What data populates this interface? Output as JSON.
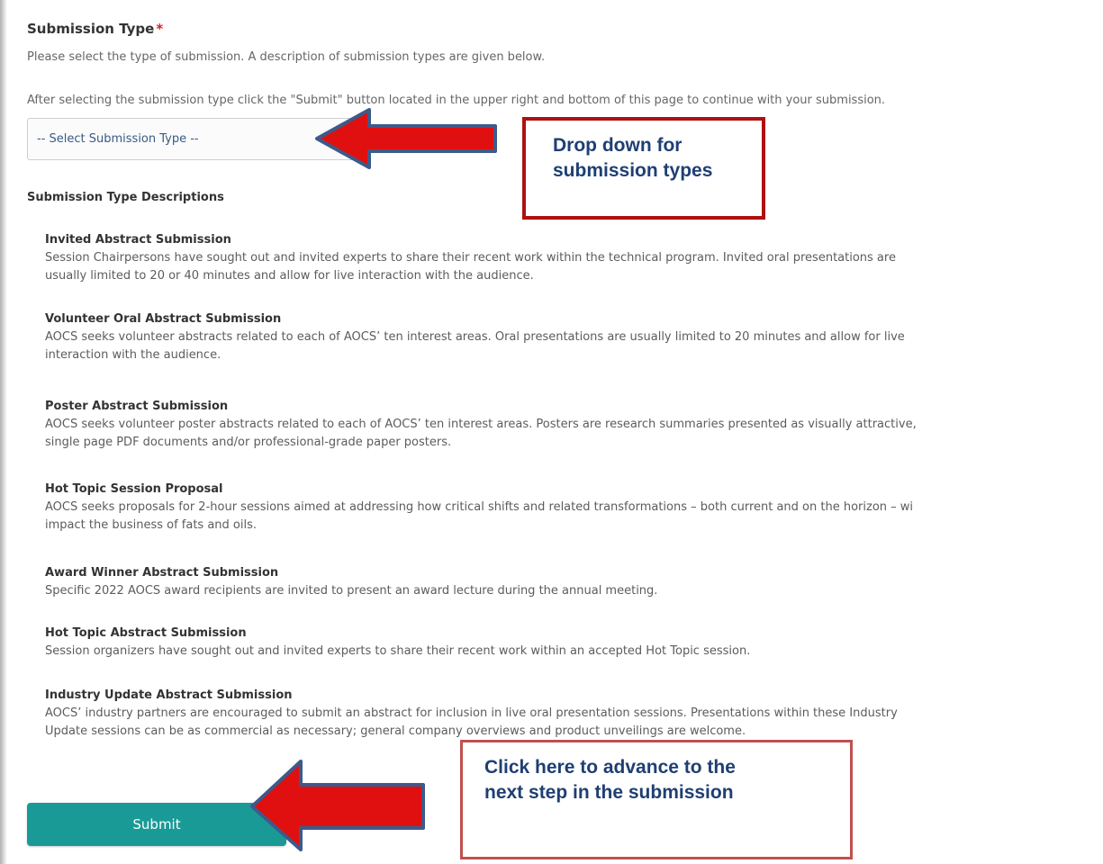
{
  "form": {
    "title": "Submission Type",
    "required_marker": "*",
    "help_line_1": "Please select the type of submission. A description of submission types are given below.",
    "help_line_2": "After selecting the submission type click the \"Submit\" button located in the upper right and bottom of this page to continue with your submission.",
    "select": {
      "selected_value": "-- Select Submission Type --"
    },
    "descriptions_heading": "Submission Type Descriptions",
    "descriptions": [
      {
        "title": "Invited Abstract Submission",
        "lines": [
          "Session Chairpersons have sought out and invited experts to share their recent work within the technical program. Invited oral presentations are",
          "usually limited to 20 or 40 minutes and allow for live interaction with the audience."
        ]
      },
      {
        "title": "Volunteer Oral Abstract Submission",
        "lines": [
          "AOCS seeks volunteer abstracts related to each of AOCS’ ten interest areas. Oral presentations are usually limited to 20 minutes and allow for live",
          "interaction with the audience."
        ]
      },
      {
        "title": "Poster Abstract Submission",
        "lines": [
          "AOCS seeks volunteer poster abstracts related to each of AOCS’ ten interest areas. Posters are research summaries presented as visually attractive,",
          "single page PDF documents and/or professional-grade paper posters."
        ]
      },
      {
        "title": "Hot Topic Session Proposal",
        "lines": [
          "AOCS seeks proposals for 2-hour sessions aimed at addressing how critical shifts and related transformations – both current and on the horizon – wi",
          "impact the business of fats and oils."
        ]
      },
      {
        "title": "Award Winner Abstract Submission",
        "lines": [
          "Specific 2022 AOCS award recipients are invited to present an award lecture during the annual meeting."
        ]
      },
      {
        "title": "Hot Topic Abstract Submission",
        "lines": [
          "Session organizers have sought out and invited experts to share their recent work within an accepted Hot Topic session."
        ]
      },
      {
        "title": "Industry Update Abstract Submission",
        "lines": [
          "AOCS’ industry partners are encouraged to submit an abstract for inclusion in live oral presentation sessions. Presentations within these Industry",
          "Update sessions can be as commercial as necessary; general company overviews and product unveilings are welcome."
        ]
      }
    ],
    "submit_label": "Submit"
  },
  "annotations": {
    "dropdown_callout": [
      "Drop down for",
      "submission types"
    ],
    "submit_callout": [
      "Click here to advance to the",
      "next step in the submission"
    ]
  },
  "colors": {
    "accent_teal": "#1a9a96",
    "arrow_red": "#e01010",
    "arrow_outline": "#3d5a8a",
    "callout_border": "#b01010",
    "callout_text": "#1f3f73",
    "required": "#e02020"
  }
}
